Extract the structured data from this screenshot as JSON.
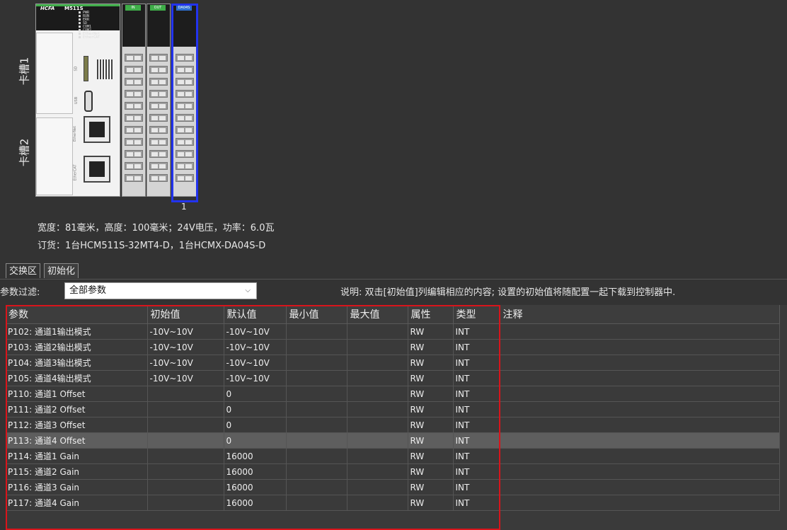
{
  "hardware": {
    "slot1_label": "卡槽1",
    "slot2_label": "卡槽2",
    "controller": {
      "brand": "HCFA",
      "model": "M511S",
      "leds": "■ PWR\n■ RUN\n■ ERR\n■ SD\n■ COM1\n■ COM2\n■ EtherNet\n■ EtherCAT",
      "port_sd": "SD",
      "port_usb": "USB",
      "port_ethernet": "EtherNet",
      "port_ethercat": "EtherCAT"
    },
    "modules": [
      {
        "tag": "IN"
      },
      {
        "tag": "OUT"
      },
      {
        "tag": "DA04S"
      }
    ],
    "selected_module_number": "1",
    "info_line1": "宽度：81毫米，高度：100毫米；24V电压，功率：6.0瓦",
    "info_line2": "订货：1台HCM511S-32MT4-D，1台HCMX-DA04S-D"
  },
  "tabs": [
    {
      "label": "交换区",
      "active": false
    },
    {
      "label": "初始化",
      "active": true
    }
  ],
  "filter": {
    "label": "参数过滤:",
    "selected": "全部参数"
  },
  "note": "说明: 双击[初始值]列编辑相应的内容; 设置的初始值将随配置一起下载到控制器中.",
  "table": {
    "headers": [
      "参数",
      "初始值",
      "默认值",
      "最小值",
      "最大值",
      "属性",
      "类型",
      "注释"
    ],
    "rows": [
      [
        "P102: 通道1输出模式",
        "-10V~10V",
        "-10V~10V",
        "",
        "",
        "RW",
        "INT",
        ""
      ],
      [
        "P103: 通道2输出模式",
        "-10V~10V",
        "-10V~10V",
        "",
        "",
        "RW",
        "INT",
        ""
      ],
      [
        "P104: 通道3输出模式",
        "-10V~10V",
        "-10V~10V",
        "",
        "",
        "RW",
        "INT",
        ""
      ],
      [
        "P105: 通道4输出模式",
        "-10V~10V",
        "-10V~10V",
        "",
        "",
        "RW",
        "INT",
        ""
      ],
      [
        "P110: 通道1 Offset",
        "",
        "0",
        "",
        "",
        "RW",
        "INT",
        ""
      ],
      [
        "P111: 通道2 Offset",
        "",
        "0",
        "",
        "",
        "RW",
        "INT",
        ""
      ],
      [
        "P112: 通道3 Offset",
        "",
        "0",
        "",
        "",
        "RW",
        "INT",
        ""
      ],
      [
        "P113: 通道4 Offset",
        "",
        "0",
        "",
        "",
        "RW",
        "INT",
        ""
      ],
      [
        "P114: 通道1 Gain",
        "",
        "16000",
        "",
        "",
        "RW",
        "INT",
        ""
      ],
      [
        "P115: 通道2 Gain",
        "",
        "16000",
        "",
        "",
        "RW",
        "INT",
        ""
      ],
      [
        "P116: 通道3 Gain",
        "",
        "16000",
        "",
        "",
        "RW",
        "INT",
        ""
      ],
      [
        "P117: 通道4 Gain",
        "",
        "16000",
        "",
        "",
        "RW",
        "INT",
        ""
      ]
    ],
    "selected_row": 7
  },
  "colors": {
    "background": "#333333",
    "highlight_box": "#d9141b",
    "module_selection": "#2233ee",
    "selected_row": "#5e5e5e"
  }
}
